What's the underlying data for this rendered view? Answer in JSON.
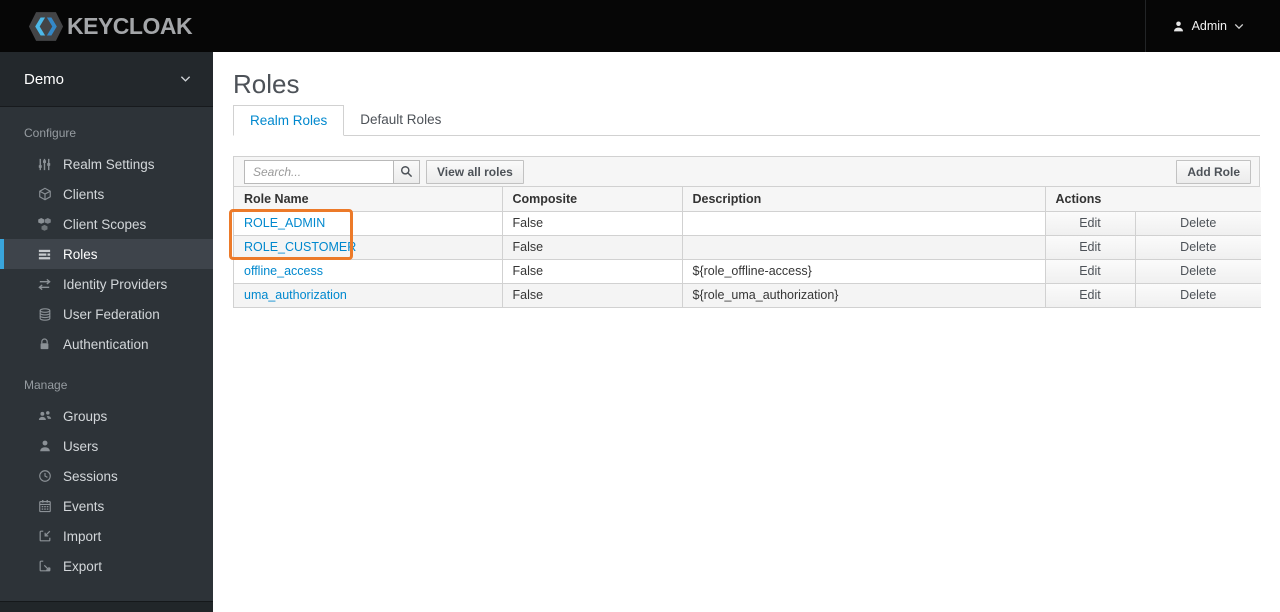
{
  "header": {
    "brand": "KEYCLOAK",
    "user": {
      "label": "Admin"
    }
  },
  "sidebar": {
    "realm": {
      "label": "Demo"
    },
    "sections": [
      {
        "label": "Configure",
        "items": [
          {
            "label": "Realm Settings",
            "icon": "sliders-icon",
            "active": false
          },
          {
            "label": "Clients",
            "icon": "cube-icon",
            "active": false
          },
          {
            "label": "Client Scopes",
            "icon": "cubes-icon",
            "active": false
          },
          {
            "label": "Roles",
            "icon": "list-icon",
            "active": true
          },
          {
            "label": "Identity Providers",
            "icon": "exchange-arrows-icon",
            "active": false
          },
          {
            "label": "User Federation",
            "icon": "database-icon",
            "active": false
          },
          {
            "label": "Authentication",
            "icon": "lock-icon",
            "active": false
          }
        ]
      },
      {
        "label": "Manage",
        "items": [
          {
            "label": "Groups",
            "icon": "group-icon",
            "active": false
          },
          {
            "label": "Users",
            "icon": "user-icon",
            "active": false
          },
          {
            "label": "Sessions",
            "icon": "clock-icon",
            "active": false
          },
          {
            "label": "Events",
            "icon": "calendar-icon",
            "active": false
          },
          {
            "label": "Import",
            "icon": "import-icon",
            "active": false
          },
          {
            "label": "Export",
            "icon": "export-icon",
            "active": false
          }
        ]
      }
    ]
  },
  "main": {
    "title": "Roles",
    "tabs": [
      {
        "label": "Realm Roles",
        "active": true
      },
      {
        "label": "Default Roles",
        "active": false
      }
    ],
    "toolbar": {
      "search_placeholder": "Search...",
      "view_all_button": "View all roles",
      "add_role_button": "Add Role"
    },
    "table": {
      "columns": [
        "Role Name",
        "Composite",
        "Description",
        "Actions"
      ],
      "row_actions": [
        "Edit",
        "Delete"
      ],
      "rows": [
        {
          "role_name": "ROLE_ADMIN",
          "composite": "False",
          "description": "",
          "highlighted": true
        },
        {
          "role_name": "ROLE_CUSTOMER",
          "composite": "False",
          "description": "",
          "highlighted": true
        },
        {
          "role_name": "offline_access",
          "composite": "False",
          "description": "${role_offline-access}",
          "highlighted": false
        },
        {
          "role_name": "uma_authorization",
          "composite": "False",
          "description": "${role_uma_authorization}",
          "highlighted": false
        }
      ]
    },
    "annotation": {
      "type": "highlight-box",
      "color": "#ec7a29"
    }
  },
  "colors": {
    "accent_blue": "#0088ce",
    "nav_active_border": "#39a5dc",
    "annotation_orange": "#ec7a29",
    "sidebar_bg": "#2d3338",
    "topbar_bg": "#060606"
  }
}
